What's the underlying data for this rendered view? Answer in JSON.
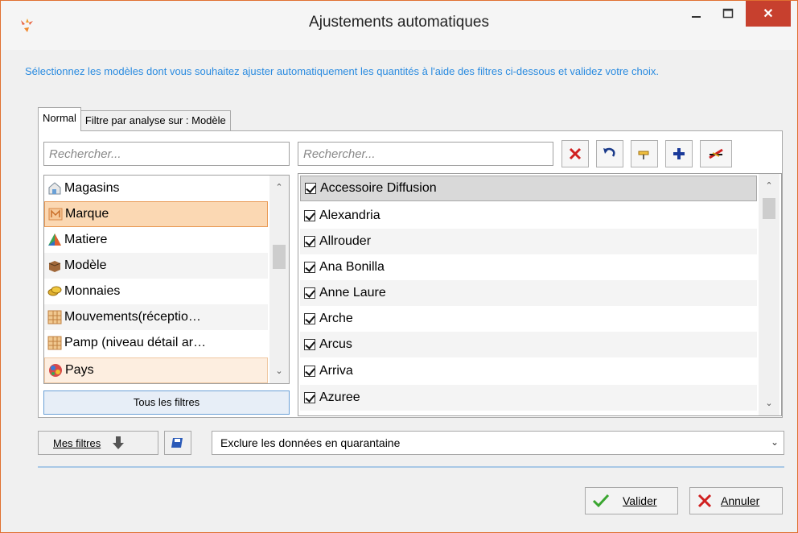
{
  "window": {
    "title": "Ajustements automatiques",
    "close_glyph": "✕"
  },
  "instruction": "Sélectionnez les modèles dont vous souhaitez ajuster automatiquement les quantités à l'aide des filtres ci-dessous et validez votre choix.",
  "tabs": [
    {
      "label": "Normal",
      "active": true
    },
    {
      "label": "Filtre par analyse sur : Modèle",
      "active": false
    }
  ],
  "left": {
    "search_placeholder": "Rechercher...",
    "items": [
      {
        "label": "Magasins",
        "icon": "store-icon",
        "state": "normal"
      },
      {
        "label": "Marque",
        "icon": "brand-icon",
        "state": "selected"
      },
      {
        "label": "Matiere",
        "icon": "material-icon",
        "state": "normal"
      },
      {
        "label": "Modèle",
        "icon": "model-box-icon",
        "state": "normal"
      },
      {
        "label": "Monnaies",
        "icon": "coins-icon",
        "state": "normal"
      },
      {
        "label": "Mouvements(réceptio…",
        "icon": "grid-icon",
        "state": "normal"
      },
      {
        "label": "Pamp (niveau détail ar…",
        "icon": "grid-icon",
        "state": "normal"
      },
      {
        "label": "Pays",
        "icon": "globe-icon",
        "state": "hover"
      }
    ],
    "all_filters_label": "Tous les filtres"
  },
  "right": {
    "search_placeholder": "Rechercher...",
    "toolbar": {
      "clear": "clear-icon",
      "undo": "undo-icon",
      "pin": "pin-icon",
      "add": "plus-icon",
      "edit": "edit-icon"
    },
    "items": [
      {
        "label": "Accessoire Diffusion",
        "checked": true
      },
      {
        "label": "Alexandria",
        "checked": true
      },
      {
        "label": "Allrouder",
        "checked": true
      },
      {
        "label": "Ana Bonilla",
        "checked": true
      },
      {
        "label": "Anne Laure",
        "checked": true
      },
      {
        "label": "Arche",
        "checked": true
      },
      {
        "label": "Arcus",
        "checked": true
      },
      {
        "label": "Arriva",
        "checked": true
      },
      {
        "label": "Azuree",
        "checked": true
      }
    ]
  },
  "bottom": {
    "my_filters_label": "Mes filtres",
    "quarantine_option": "Exclure les données en quarantaine"
  },
  "actions": {
    "validate_label": "Valider",
    "cancel_label": "Annuler"
  },
  "colors": {
    "accent_text": "#2a8be0",
    "selection": "#fbd8b3",
    "close_button": "#c7402e"
  }
}
